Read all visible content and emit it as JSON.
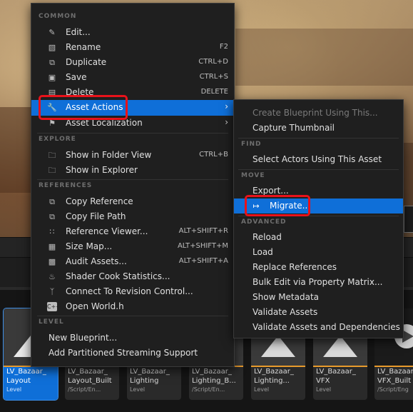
{
  "menu": {
    "sections": {
      "common": "COMMON",
      "explore": "EXPLORE",
      "references": "REFERENCES",
      "level": "LEVEL"
    },
    "items": [
      {
        "label": "Edit...",
        "icon": "pencil-icon",
        "shortcut": ""
      },
      {
        "label": "Rename",
        "icon": "rename-icon",
        "shortcut": "F2"
      },
      {
        "label": "Duplicate",
        "icon": "duplicate-icon",
        "shortcut": "CTRL+D"
      },
      {
        "label": "Save",
        "icon": "save-icon",
        "shortcut": "CTRL+S"
      },
      {
        "label": "Delete",
        "icon": "trash-icon",
        "shortcut": "DELETE"
      },
      {
        "label": "Asset Actions",
        "icon": "wrench-icon",
        "shortcut": ""
      },
      {
        "label": "Asset Localization",
        "icon": "flag-icon",
        "shortcut": ""
      },
      {
        "label": "Show in Folder View",
        "icon": "folder-search-icon",
        "shortcut": "CTRL+B"
      },
      {
        "label": "Show in Explorer",
        "icon": "folder-search-icon",
        "shortcut": ""
      },
      {
        "label": "Copy Reference",
        "icon": "copy-icon",
        "shortcut": ""
      },
      {
        "label": "Copy File Path",
        "icon": "copy-icon",
        "shortcut": ""
      },
      {
        "label": "Reference Viewer...",
        "icon": "reference-viewer-icon",
        "shortcut": "ALT+SHIFT+R"
      },
      {
        "label": "Size Map...",
        "icon": "size-map-icon",
        "shortcut": "ALT+SHIFT+M"
      },
      {
        "label": "Audit Assets...",
        "icon": "audit-icon",
        "shortcut": "ALT+SHIFT+A"
      },
      {
        "label": "Shader Cook Statistics...",
        "icon": "shader-stats-icon",
        "shortcut": ""
      },
      {
        "label": "Connect To Revision Control...",
        "icon": "revision-control-icon",
        "shortcut": ""
      },
      {
        "label": "Open World.h",
        "icon": "cpp-file-icon",
        "shortcut": ""
      },
      {
        "label": "New Blueprint...",
        "icon": "",
        "shortcut": ""
      },
      {
        "label": "Add Partitioned Streaming Support",
        "icon": "",
        "shortcut": ""
      }
    ]
  },
  "submenu": {
    "sections": {
      "find": "FIND",
      "move": "MOVE",
      "advanced": "ADVANCED"
    },
    "items": [
      {
        "label": "Create Blueprint Using This..."
      },
      {
        "label": "Capture Thumbnail"
      },
      {
        "label": "Select Actors Using This Asset"
      },
      {
        "label": "Export..."
      },
      {
        "label": "Migrate...",
        "icon": "migrate-icon"
      },
      {
        "label": "Reload"
      },
      {
        "label": "Load"
      },
      {
        "label": "Replace References"
      },
      {
        "label": "Bulk Edit via Property Matrix..."
      },
      {
        "label": "Show Metadata"
      },
      {
        "label": "Validate Assets"
      },
      {
        "label": "Validate Assets and Dependencies"
      }
    ]
  },
  "tiles": [
    {
      "line1": "LV_Bazaar_",
      "line2": "Layout",
      "type": "Level"
    },
    {
      "line1": "LV_Bazaar_",
      "line2": "Layout_Built",
      "type": "/Script/En..."
    },
    {
      "line1": "LV_Bazaar_",
      "line2": "Lighting",
      "type": "Level"
    },
    {
      "line1": "LV_Bazaar_",
      "line2": "Lighting_B...",
      "type": "/Script/En..."
    },
    {
      "line1": "LV_Bazaar_",
      "line2": "Lighting...",
      "type": "Level"
    },
    {
      "line1": "LV_Bazaar_",
      "line2": "VFX",
      "type": "Level"
    },
    {
      "line1": "LV_Bazaar_",
      "line2": "VFX_Built",
      "type": "/Script/Eng"
    }
  ],
  "colors": {
    "selection": "#0f6fd8",
    "highlight_box": "#e8121a",
    "menu_bg": "#1f1f1f",
    "level_accent": "#e89a2c"
  }
}
